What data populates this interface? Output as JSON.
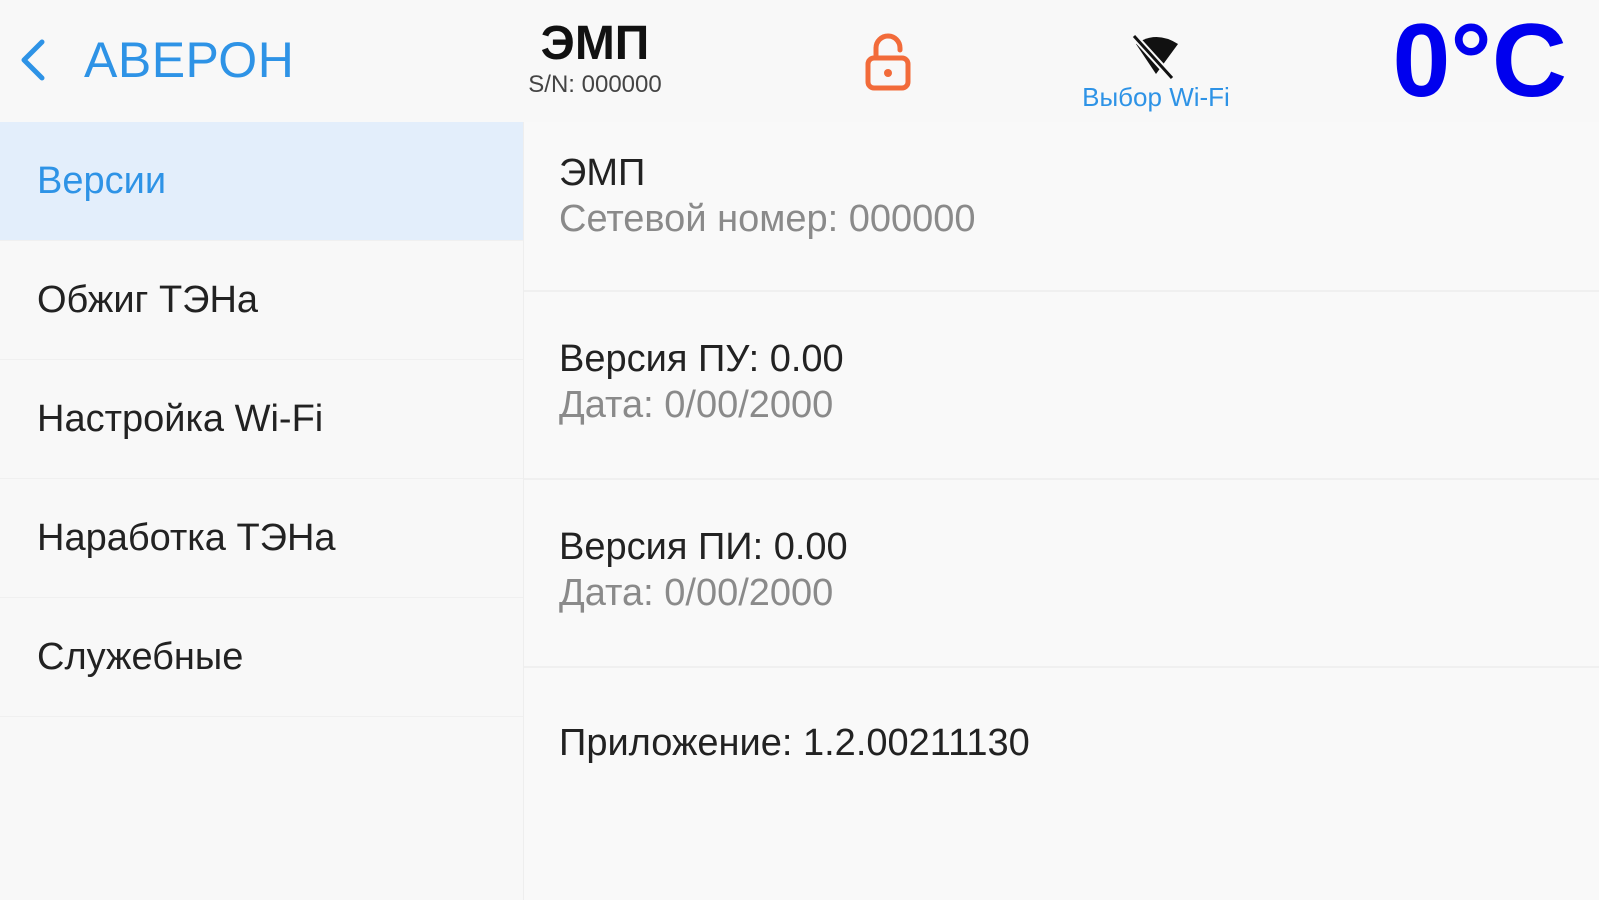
{
  "header": {
    "back_label": "АВЕРОН",
    "device_name": "ЭМП",
    "serial": "S/N: 000000",
    "wifi_label": "Выбор Wi-Fi",
    "temperature": "0°C",
    "temperature_color": "#0000ee",
    "lock_color": "#f26b3a",
    "accent_color": "#2e93e6",
    "icons": [
      "chevron-left-icon",
      "unlocked-padlock-icon",
      "wifi-off-icon"
    ]
  },
  "sidebar": {
    "items": [
      {
        "label": "Версии",
        "active": true
      },
      {
        "label": "Обжиг ТЭНа",
        "active": false
      },
      {
        "label": "Настройка Wi-Fi",
        "active": false
      },
      {
        "label": "Наработка ТЭНа",
        "active": false
      },
      {
        "label": "Служебные",
        "active": false
      }
    ]
  },
  "main": {
    "device": {
      "name": "ЭМП",
      "network_number": "Сетевой номер: 000000"
    },
    "pu": {
      "version": "Версия ПУ: 0.00",
      "date": "Дата: 0/00/2000"
    },
    "pi": {
      "version": "Версия ПИ: 0.00",
      "date": "Дата: 0/00/2000"
    },
    "app_version": "Приложение: 1.2.00211130"
  }
}
